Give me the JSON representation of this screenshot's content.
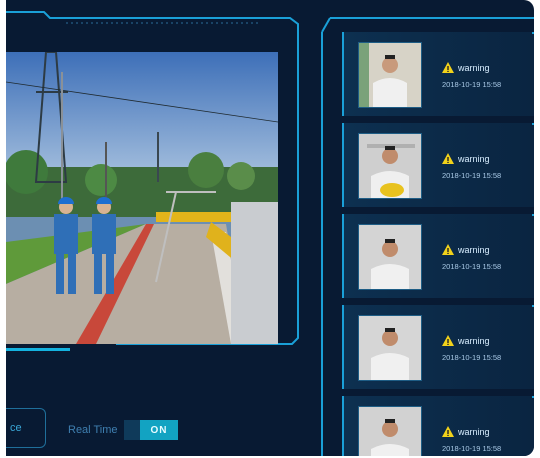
{
  "controls": {
    "left_button_label": "ce",
    "realtime_label": "Real Time",
    "toggle_on_label": "ON"
  },
  "alerts": [
    {
      "status": "warning",
      "time": "2018-10-19 15:58"
    },
    {
      "status": "warning",
      "time": "2018-10-19 15:58"
    },
    {
      "status": "warning",
      "time": "2018-10-19 15:58"
    },
    {
      "status": "warning",
      "time": "2018-10-19 15:58"
    },
    {
      "status": "warning",
      "time": "2018-10-19 15:58"
    }
  ],
  "colors": {
    "background": "#081a33",
    "accent": "#1aa0d8",
    "toggle_on": "#12a3c2",
    "warning_icon": "#f2d21b"
  }
}
